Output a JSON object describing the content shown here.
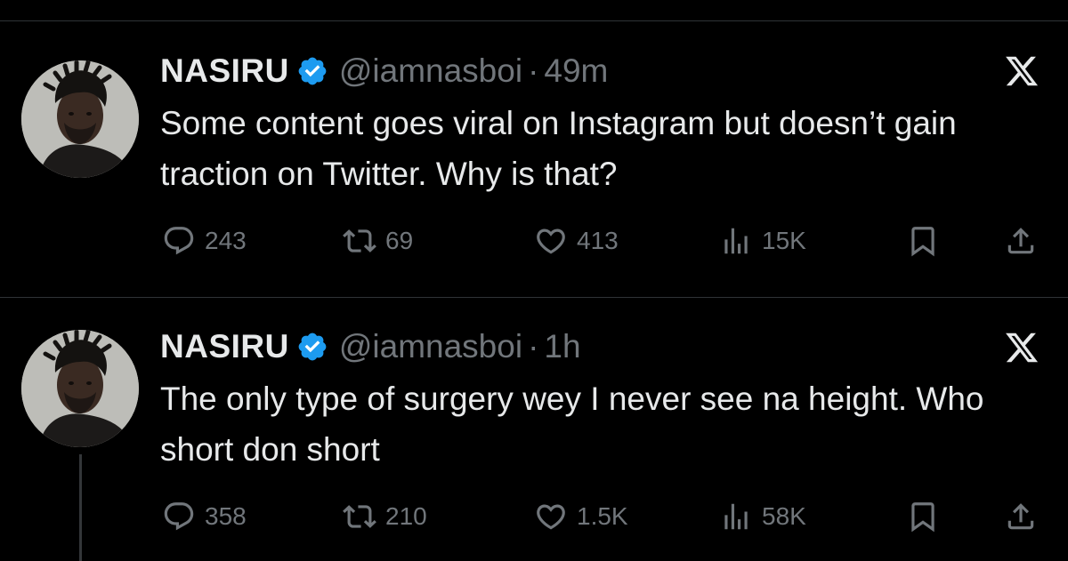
{
  "colors": {
    "background": "#000000",
    "text_primary": "#e7e9ea",
    "text_secondary": "#71767b",
    "divider": "#2f3336",
    "verified_badge": "#1d9bf0"
  },
  "tweets": [
    {
      "author_name": "NASIRU",
      "handle": "@iamnasboi",
      "separator": "·",
      "time": "49m",
      "verified": true,
      "text": "Some content goes viral on Instagram but doesn’t gain traction on Twitter. Why is that?",
      "replies": "243",
      "retweets": "69",
      "likes": "413",
      "views": "15K",
      "icons": [
        "avatar",
        "verified-badge-icon",
        "x-logo-icon",
        "reply-icon",
        "retweet-icon",
        "like-icon",
        "views-icon",
        "bookmark-icon",
        "share-icon"
      ]
    },
    {
      "author_name": "NASIRU",
      "handle": "@iamnasboi",
      "separator": "·",
      "time": "1h",
      "verified": true,
      "text": "The only type of surgery wey I never see na height. Who short don short",
      "replies": "358",
      "retweets": "210",
      "likes": "1.5K",
      "views": "58K",
      "icons": [
        "avatar",
        "verified-badge-icon",
        "x-logo-icon",
        "reply-icon",
        "retweet-icon",
        "like-icon",
        "views-icon",
        "bookmark-icon",
        "share-icon"
      ]
    }
  ]
}
